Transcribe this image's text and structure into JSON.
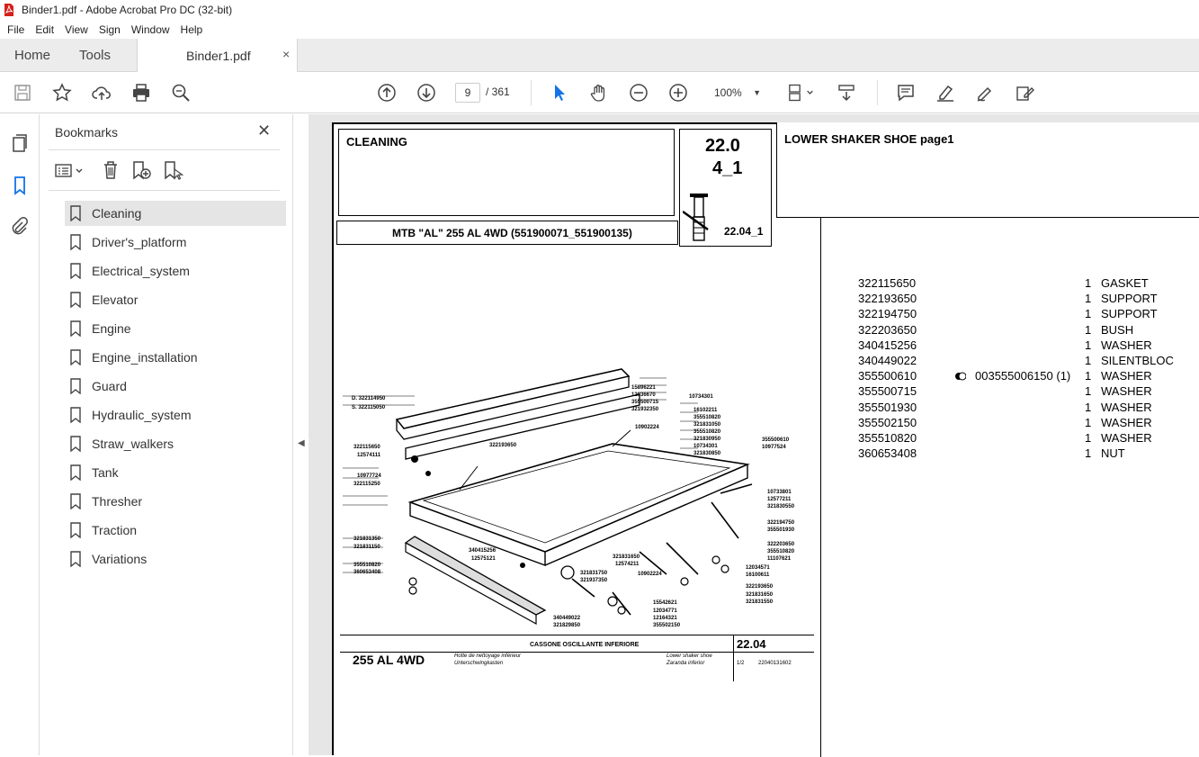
{
  "window": {
    "title": "Binder1.pdf - Adobe Acrobat Pro DC (32-bit)"
  },
  "menu": [
    "File",
    "Edit",
    "View",
    "Sign",
    "Window",
    "Help"
  ],
  "tabs": {
    "home": "Home",
    "tools": "Tools",
    "document": "Binder1.pdf",
    "close": "×"
  },
  "toolbar": {
    "page_current": "9",
    "page_total": "/   361",
    "zoom": "100%"
  },
  "bookmarks": {
    "title": "Bookmarks",
    "close": "✕",
    "items": [
      {
        "label": "Cleaning",
        "selected": true
      },
      {
        "label": "Driver's_platform"
      },
      {
        "label": "Electrical_system"
      },
      {
        "label": "Elevator"
      },
      {
        "label": "Engine"
      },
      {
        "label": "Engine_installation"
      },
      {
        "label": "Guard"
      },
      {
        "label": "Hydraulic_system"
      },
      {
        "label": "Straw_walkers"
      },
      {
        "label": "Tank"
      },
      {
        "label": "Thresher"
      },
      {
        "label": "Traction"
      },
      {
        "label": "Variations"
      }
    ]
  },
  "document": {
    "group": "CLEANING",
    "ref_top": "22.0",
    "ref_mid": "4_1",
    "ref_small": "22.04_1",
    "model": "MTB \"AL\" 255 AL 4WD (551900071_551900135)",
    "section_title": "LOWER SHAKER SHOE  page1",
    "drawing": {
      "title_it": "CASSONE OSCILLANTE INFERIORE",
      "model": "255 AL 4WD",
      "title_fr": "Hotte de nettoyage inférieur",
      "title_de": "Unterschwingkasten",
      "title_en": "Lower shaker shoe",
      "title_es": "Zaranda inferior",
      "table_no": "22.04",
      "sheet": "1/2",
      "drawing_no": "22040131602",
      "callouts": [
        "D. 322114950",
        "S. 322115050",
        "15896221",
        "12036670",
        "355500715",
        "321932350",
        "10734301",
        "16102211",
        "355510820",
        "321831050",
        "355510820",
        "321830950",
        "10734301",
        "321830850",
        "10902224",
        "355500610",
        "10977524",
        "322115650",
        "12574111",
        "322193650",
        "10977724",
        "322115250",
        "10733801",
        "12577211",
        "321830550",
        "322194750",
        "355501930",
        "322203650",
        "355510820",
        "11107621",
        "321831350",
        "321831150",
        "340415256",
        "12575121",
        "355510820",
        "360653408",
        "321831650",
        "12574211",
        "12034571",
        "16100611",
        "321831750",
        "321937350",
        "10902224",
        "322193650",
        "321831650",
        "321831550",
        "15542621",
        "12034771",
        "12164321",
        "355502150",
        "340449022",
        "321829850"
      ]
    },
    "parts": [
      {
        "code": "322115650",
        "note": "",
        "qty": "1",
        "desc": "GASKET"
      },
      {
        "code": "322193650",
        "note": "",
        "qty": "1",
        "desc": "SUPPORT"
      },
      {
        "code": "322194750",
        "note": "",
        "qty": "1",
        "desc": "SUPPORT"
      },
      {
        "code": "322203650",
        "note": "",
        "qty": "1",
        "desc": "BUSH"
      },
      {
        "code": "340415256",
        "note": "",
        "qty": "1",
        "desc": "WASHER"
      },
      {
        "code": "340449022",
        "note": "",
        "qty": "1",
        "desc": "SILENTBLOC"
      },
      {
        "code": "355500610",
        "note": "003555006150  (1)",
        "qty": "1",
        "desc": "WASHER"
      },
      {
        "code": "355500715",
        "note": "",
        "qty": "1",
        "desc": "WASHER"
      },
      {
        "code": "355501930",
        "note": "",
        "qty": "1",
        "desc": "WASHER"
      },
      {
        "code": "355502150",
        "note": "",
        "qty": "1",
        "desc": "WASHER"
      },
      {
        "code": "355510820",
        "note": "",
        "qty": "1",
        "desc": "WASHER"
      },
      {
        "code": "360653408",
        "note": "",
        "qty": "1",
        "desc": "NUT"
      }
    ]
  }
}
